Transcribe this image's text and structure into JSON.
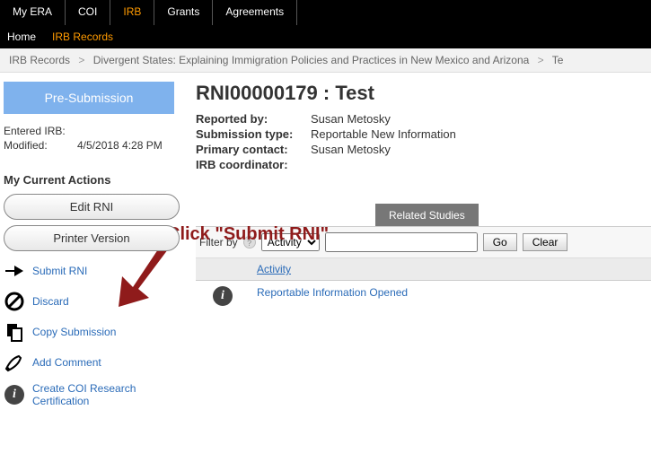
{
  "topnav": {
    "tabs": [
      {
        "label": "My ERA"
      },
      {
        "label": "COI"
      },
      {
        "label": "IRB"
      },
      {
        "label": "Grants"
      },
      {
        "label": "Agreements"
      }
    ],
    "active_index": 2
  },
  "subnav": {
    "items": [
      {
        "label": "Home"
      },
      {
        "label": "IRB Records"
      }
    ],
    "active_index": 1
  },
  "breadcrumb": {
    "items": [
      "IRB Records",
      "Divergent States: Explaining Immigration Policies and Practices in New Mexico and Arizona",
      "Te"
    ]
  },
  "status": {
    "label": "Pre-Submission"
  },
  "left_meta": {
    "entered_label": "Entered IRB:",
    "entered_value": "",
    "modified_label": "Modified:",
    "modified_value": "4/5/2018 4:28 PM"
  },
  "actions_header": "My Current Actions",
  "pills": [
    {
      "label": "Edit RNI"
    },
    {
      "label": "Printer Version"
    }
  ],
  "actions": [
    {
      "label": "Submit RNI",
      "icon": "arrow"
    },
    {
      "label": "Discard",
      "icon": "no"
    },
    {
      "label": "Copy Submission",
      "icon": "copy"
    },
    {
      "label": "Add Comment",
      "icon": "pencil"
    },
    {
      "label": "Create COI Research Certification",
      "icon": "info"
    }
  ],
  "record": {
    "title": "RNI00000179 : Test",
    "reported_by_label": "Reported by:",
    "reported_by_value": "Susan Metosky",
    "submission_type_label": "Submission type:",
    "submission_type_value": "Reportable New Information",
    "primary_contact_label": "Primary contact:",
    "primary_contact_value": "Susan Metosky",
    "irb_coordinator_label": "IRB coordinator:",
    "irb_coordinator_value": ""
  },
  "tabs3": {
    "items": [
      {
        "label": "Related Studies",
        "visible": true
      }
    ]
  },
  "filter": {
    "label": "Filter by",
    "dropdown_value": "Activity",
    "search_value": "",
    "go": "Go",
    "clear": "Clear"
  },
  "grid": {
    "header": "Activity",
    "rows": [
      {
        "text": "Reportable Information Opened"
      }
    ]
  },
  "overlay": {
    "text": "Click \"Submit RNI\""
  }
}
